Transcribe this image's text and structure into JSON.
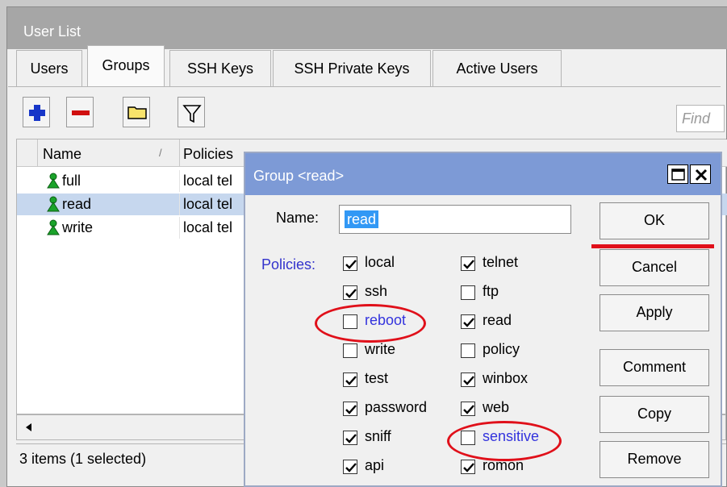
{
  "main": {
    "title": "User List",
    "tabs": [
      {
        "label": "Users"
      },
      {
        "label": "Groups"
      },
      {
        "label": "SSH Keys"
      },
      {
        "label": "SSH Private Keys"
      },
      {
        "label": "Active Users"
      }
    ],
    "find_placeholder": "Find",
    "columns": [
      "Name",
      "Policies"
    ],
    "sort_indicator": "/",
    "rows": [
      {
        "name": "full",
        "policies": "local tel",
        "selected": false
      },
      {
        "name": "read",
        "policies": "local tel",
        "selected": true
      },
      {
        "name": "write",
        "policies": "local tel",
        "selected": false
      }
    ],
    "status": "3 items (1 selected)"
  },
  "dialog": {
    "title": "Group <read>",
    "name_label": "Name:",
    "name_value": "read",
    "policies_label": "Policies:",
    "policies_left": [
      {
        "label": "local",
        "checked": true
      },
      {
        "label": "ssh",
        "checked": true
      },
      {
        "label": "reboot",
        "checked": false
      },
      {
        "label": "write",
        "checked": false
      },
      {
        "label": "test",
        "checked": true
      },
      {
        "label": "password",
        "checked": true
      },
      {
        "label": "sniff",
        "checked": true
      },
      {
        "label": "api",
        "checked": true
      }
    ],
    "policies_right": [
      {
        "label": "telnet",
        "checked": true
      },
      {
        "label": "ftp",
        "checked": false
      },
      {
        "label": "read",
        "checked": true
      },
      {
        "label": "policy",
        "checked": false
      },
      {
        "label": "winbox",
        "checked": true
      },
      {
        "label": "web",
        "checked": true
      },
      {
        "label": "sensitive",
        "checked": false
      },
      {
        "label": "romon",
        "checked": true
      }
    ],
    "buttons": {
      "ok": "OK",
      "cancel": "Cancel",
      "apply": "Apply",
      "comment": "Comment",
      "copy": "Copy",
      "remove": "Remove"
    }
  },
  "colors": {
    "annotation": "#e0101a",
    "selection": "#3298f5",
    "policy_link": "#3333cc",
    "user_icon": "#1aa32a"
  },
  "icons": [
    "add-icon",
    "remove-icon",
    "comment-icon",
    "filter-icon",
    "user-group-icon",
    "maximize-icon",
    "close-icon",
    "scroll-left-icon"
  ]
}
